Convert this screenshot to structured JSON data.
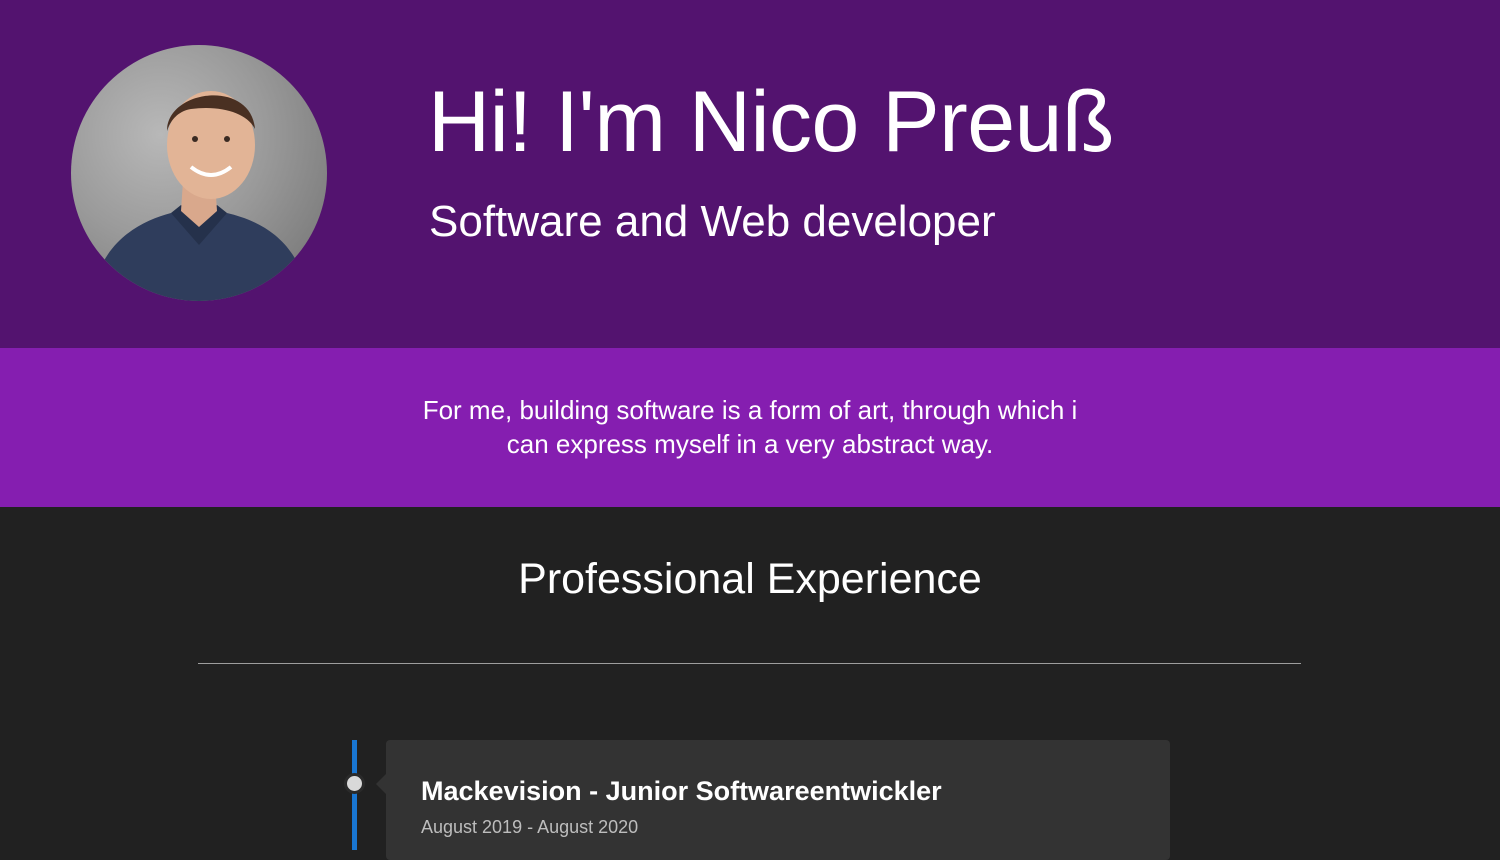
{
  "hero": {
    "title": "Hi! I'm Nico Preuß",
    "subtitle": "Software and Web developer",
    "avatar_icon": "profile-photo",
    "background": "#53136f"
  },
  "quote": {
    "text": "For me, building software is a form of art, through which i can express myself in a very abstract way.",
    "background": "#851eb0"
  },
  "experience": {
    "title": "Professional Experience",
    "accent": "#1976d2",
    "items": [
      {
        "title": "Mackevision - Junior Softwareentwickler",
        "dates": "August 2019 - August 2020"
      }
    ]
  }
}
